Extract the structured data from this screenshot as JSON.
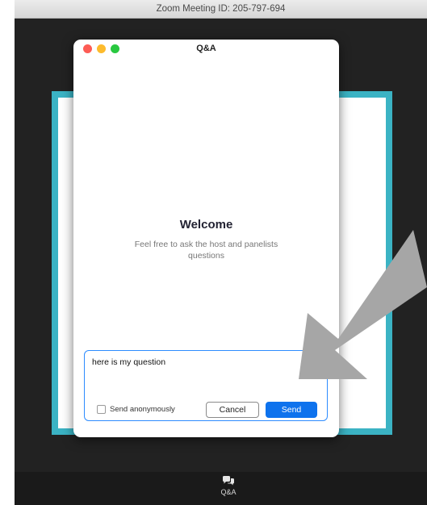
{
  "window": {
    "title": "Zoom Meeting ID: 205-797-694"
  },
  "qa_dialog": {
    "title": "Q&A",
    "welcome_title": "Welcome",
    "welcome_subtitle": "Feel free to ask the host and panelists questions",
    "question_value": "here is my question",
    "anonymous_label": "Send anonymously",
    "anonymous_checked": false,
    "cancel_label": "Cancel",
    "send_label": "Send"
  },
  "toolbar": {
    "qa_label": "Q&A",
    "qa_icon": "chat-bubbles-icon"
  },
  "colors": {
    "accent": "#0e72ed",
    "share_border": "#3bb3c4",
    "background": "#222222",
    "annotation_arrow": "#a6a6a6"
  }
}
